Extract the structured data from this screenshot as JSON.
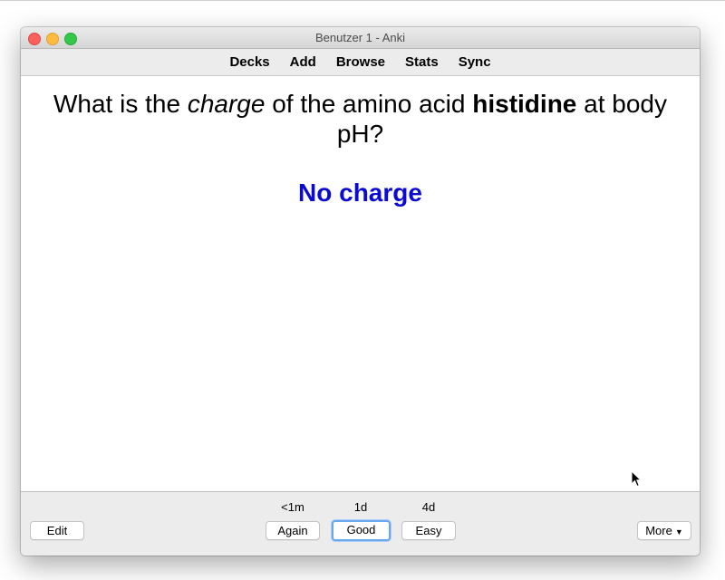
{
  "window": {
    "title": "Benutzer 1 - Anki"
  },
  "toolbar": {
    "items": [
      "Decks",
      "Add",
      "Browse",
      "Stats",
      "Sync"
    ]
  },
  "card": {
    "question": {
      "part1": "What is the ",
      "italic": "charge",
      "part2": " of the amino acid ",
      "bold": "histidine",
      "part3": " at body pH?"
    },
    "answer": "No charge"
  },
  "answer_buttons": [
    {
      "interval": "<1m",
      "label": "Again"
    },
    {
      "interval": "1d",
      "label": "Good",
      "focused": true
    },
    {
      "interval": "4d",
      "label": "Easy"
    }
  ],
  "bottom": {
    "edit_label": "Edit",
    "more_label": "More"
  },
  "colors": {
    "answer": "#0a0ad2",
    "focus_ring": "#6aa7ef"
  }
}
